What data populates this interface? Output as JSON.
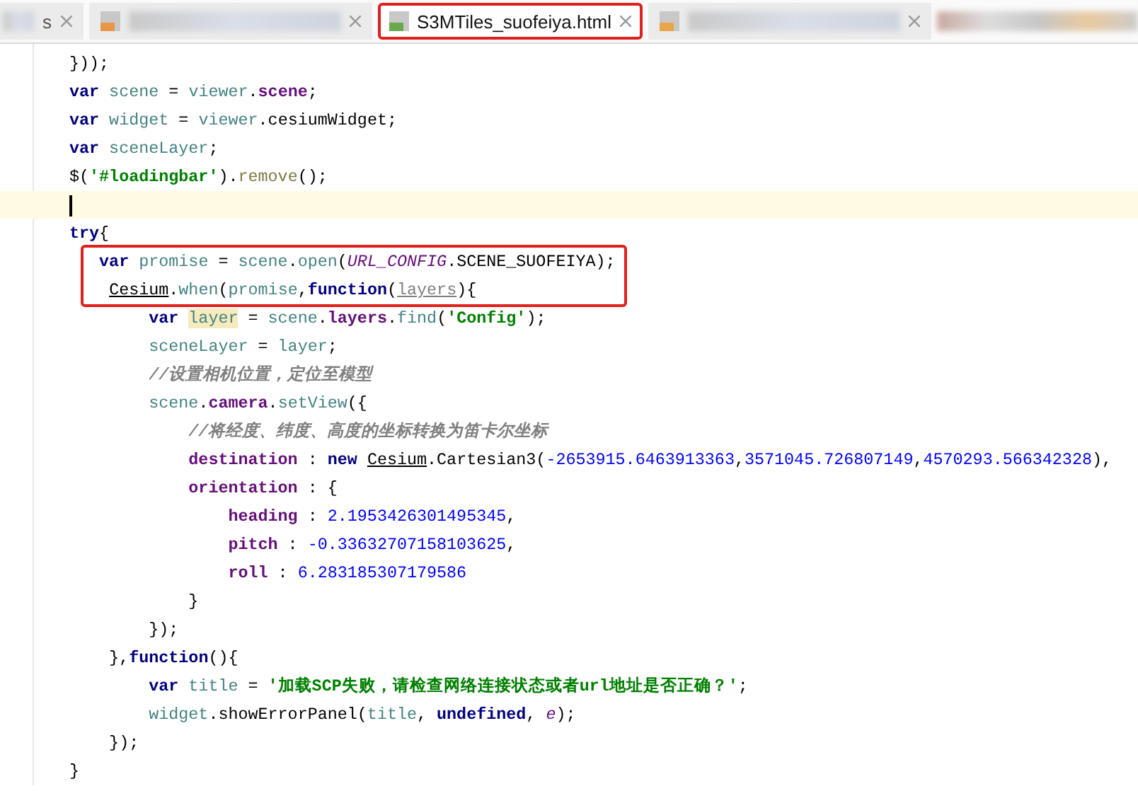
{
  "tabs": [
    {
      "label": "s",
      "kind": "plain",
      "selected": false,
      "boxed": false,
      "redacted": true
    },
    {
      "kind": "jsp",
      "selected": false,
      "boxed": false,
      "redacted": true
    },
    {
      "label": "S3MTiles_suofeiya.html",
      "kind": "html",
      "selected": true,
      "boxed": true,
      "redacted": false
    },
    {
      "kind": "js",
      "selected": false,
      "boxed": false,
      "redacted": true
    }
  ],
  "code_lines": [
    {
      "current": false,
      "boxed": false,
      "tokens": [
        {
          "kind": "plain",
          "text": "}));"
        }
      ]
    },
    {
      "current": false,
      "boxed": false,
      "tokens": [
        {
          "kind": "kw",
          "text": "var"
        },
        {
          "kind": "local",
          "text": " scene"
        },
        {
          "kind": "plain",
          "text": " = "
        },
        {
          "kind": "local",
          "text": "viewer"
        },
        {
          "kind": "plain",
          "text": "."
        },
        {
          "kind": "field",
          "text": "scene"
        },
        {
          "kind": "plain",
          "text": ";"
        }
      ]
    },
    {
      "current": false,
      "boxed": false,
      "tokens": [
        {
          "kind": "kw",
          "text": "var"
        },
        {
          "kind": "local",
          "text": " widget"
        },
        {
          "kind": "plain",
          "text": " = "
        },
        {
          "kind": "local",
          "text": "viewer"
        },
        {
          "kind": "plain",
          "text": ".cesiumWidget;"
        }
      ]
    },
    {
      "current": false,
      "boxed": false,
      "tokens": [
        {
          "kind": "kw",
          "text": "var"
        },
        {
          "kind": "local",
          "text": " sceneLayer"
        },
        {
          "kind": "plain",
          "text": ";"
        }
      ]
    },
    {
      "current": false,
      "boxed": false,
      "tokens": [
        {
          "kind": "plain",
          "text": "$("
        },
        {
          "kind": "str",
          "text": "'#loadingbar'"
        },
        {
          "kind": "plain",
          "text": ")."
        },
        {
          "kind": "fn2",
          "text": "remove"
        },
        {
          "kind": "plain",
          "text": "();"
        }
      ]
    },
    {
      "current": true,
      "boxed": false
    },
    {
      "current": false,
      "boxed": false,
      "tokens": [
        {
          "kind": "kw",
          "text": "try"
        },
        {
          "kind": "plain",
          "text": "{"
        }
      ]
    },
    {
      "current": false,
      "boxed": true,
      "tokens": [
        {
          "kind": "kw",
          "text": "   var"
        },
        {
          "kind": "local",
          "text": " promise"
        },
        {
          "kind": "plain",
          "text": " = "
        },
        {
          "kind": "local",
          "text": "scene"
        },
        {
          "kind": "plain",
          "text": "."
        },
        {
          "kind": "fn",
          "text": "open"
        },
        {
          "kind": "plain",
          "text": "("
        },
        {
          "kind": "constant",
          "text": "URL_CONFIG"
        },
        {
          "kind": "plain",
          "text": ".SCENE_SUOFEIYA);"
        }
      ]
    },
    {
      "current": false,
      "boxed": true,
      "tokens": [
        {
          "kind": "cls",
          "text": "    Cesium"
        },
        {
          "kind": "plain",
          "text": "."
        },
        {
          "kind": "fn",
          "text": "when"
        },
        {
          "kind": "plain",
          "text": "("
        },
        {
          "kind": "local",
          "text": "promise"
        },
        {
          "kind": "plain",
          "text": ","
        },
        {
          "kind": "kw",
          "text": "function"
        },
        {
          "kind": "plain",
          "text": "("
        },
        {
          "kind": "param",
          "text": "layers"
        },
        {
          "kind": "plain",
          "text": "){"
        }
      ]
    },
    {
      "current": false,
      "boxed": false,
      "tokens": [
        {
          "kind": "kw",
          "text": "        var "
        },
        {
          "kind": "hl",
          "text": "layer"
        },
        {
          "kind": "plain",
          "text": " = "
        },
        {
          "kind": "local",
          "text": "scene"
        },
        {
          "kind": "plain",
          "text": "."
        },
        {
          "kind": "field",
          "text": "layers"
        },
        {
          "kind": "plain",
          "text": "."
        },
        {
          "kind": "fn",
          "text": "find"
        },
        {
          "kind": "plain",
          "text": "("
        },
        {
          "kind": "str",
          "text": "'Config'"
        },
        {
          "kind": "plain",
          "text": ");"
        }
      ]
    },
    {
      "current": false,
      "boxed": false,
      "tokens": [
        {
          "kind": "local",
          "text": "        sceneLayer"
        },
        {
          "kind": "plain",
          "text": " = "
        },
        {
          "kind": "local",
          "text": "layer"
        },
        {
          "kind": "plain",
          "text": ";"
        }
      ]
    },
    {
      "current": false,
      "boxed": false,
      "tokens": [
        {
          "kind": "comment",
          "text": "        //设置相机位置，定位至模型"
        }
      ]
    },
    {
      "current": false,
      "boxed": false,
      "tokens": [
        {
          "kind": "local",
          "text": "        scene"
        },
        {
          "kind": "plain",
          "text": "."
        },
        {
          "kind": "field",
          "text": "camera"
        },
        {
          "kind": "plain",
          "text": "."
        },
        {
          "kind": "fn",
          "text": "setView"
        },
        {
          "kind": "plain",
          "text": "({"
        }
      ]
    },
    {
      "current": false,
      "boxed": false,
      "tokens": [
        {
          "kind": "comment",
          "text": "            //将经度、纬度、高度的坐标转换为笛卡尔坐标"
        }
      ]
    },
    {
      "current": false,
      "boxed": false,
      "tokens": [
        {
          "kind": "field",
          "text": "            destination"
        },
        {
          "kind": "plain",
          "text": " : "
        },
        {
          "kind": "kw",
          "text": "new"
        },
        {
          "kind": "cls",
          "text": " Cesium"
        },
        {
          "kind": "plain",
          "text": ".Cartesian3("
        },
        {
          "kind": "num",
          "text": "-2653915.6463913363"
        },
        {
          "kind": "plain",
          "text": ","
        },
        {
          "kind": "num",
          "text": "3571045.726807149"
        },
        {
          "kind": "plain",
          "text": ","
        },
        {
          "kind": "num",
          "text": "4570293.566342328"
        },
        {
          "kind": "plain",
          "text": "),"
        }
      ]
    },
    {
      "current": false,
      "boxed": false,
      "tokens": [
        {
          "kind": "field",
          "text": "            orientation"
        },
        {
          "kind": "plain",
          "text": " : {"
        }
      ]
    },
    {
      "current": false,
      "boxed": false,
      "tokens": [
        {
          "kind": "field",
          "text": "                heading"
        },
        {
          "kind": "plain",
          "text": " : "
        },
        {
          "kind": "num",
          "text": "2.1953426301495345"
        },
        {
          "kind": "plain",
          "text": ","
        }
      ]
    },
    {
      "current": false,
      "boxed": false,
      "tokens": [
        {
          "kind": "field",
          "text": "                pitch"
        },
        {
          "kind": "plain",
          "text": " : "
        },
        {
          "kind": "num",
          "text": "-0.33632707158103625"
        },
        {
          "kind": "plain",
          "text": ","
        }
      ]
    },
    {
      "current": false,
      "boxed": false,
      "tokens": [
        {
          "kind": "field",
          "text": "                roll"
        },
        {
          "kind": "plain",
          "text": " : "
        },
        {
          "kind": "num",
          "text": "6.283185307179586"
        }
      ]
    },
    {
      "current": false,
      "boxed": false,
      "tokens": [
        {
          "kind": "plain",
          "text": "            }"
        }
      ]
    },
    {
      "current": false,
      "boxed": false,
      "tokens": [
        {
          "kind": "plain",
          "text": "        });"
        }
      ]
    },
    {
      "current": false,
      "boxed": false,
      "tokens": [
        {
          "kind": "plain",
          "text": "    },"
        },
        {
          "kind": "kw",
          "text": "function"
        },
        {
          "kind": "plain",
          "text": "(){"
        }
      ]
    },
    {
      "current": false,
      "boxed": false,
      "tokens": [
        {
          "kind": "kw",
          "text": "        var"
        },
        {
          "kind": "local",
          "text": " title"
        },
        {
          "kind": "plain",
          "text": " = "
        },
        {
          "kind": "str",
          "text": "'加载SCP失败，请检查网络连接状态或者url地址是否正确？'"
        },
        {
          "kind": "plain",
          "text": ";"
        }
      ]
    },
    {
      "current": false,
      "boxed": false,
      "tokens": [
        {
          "kind": "local",
          "text": "        widget"
        },
        {
          "kind": "plain",
          "text": ".showErrorPanel("
        },
        {
          "kind": "local",
          "text": "title"
        },
        {
          "kind": "plain",
          "text": ", "
        },
        {
          "kind": "kw",
          "text": "undefined"
        },
        {
          "kind": "plain",
          "text": ", "
        },
        {
          "kind": "iparam",
          "text": "e"
        },
        {
          "kind": "plain",
          "text": ");"
        }
      ]
    },
    {
      "current": false,
      "boxed": false,
      "tokens": [
        {
          "kind": "plain",
          "text": "    });"
        }
      ]
    },
    {
      "current": false,
      "boxed": false,
      "tokens": [
        {
          "kind": "plain",
          "text": "}"
        }
      ]
    }
  ]
}
